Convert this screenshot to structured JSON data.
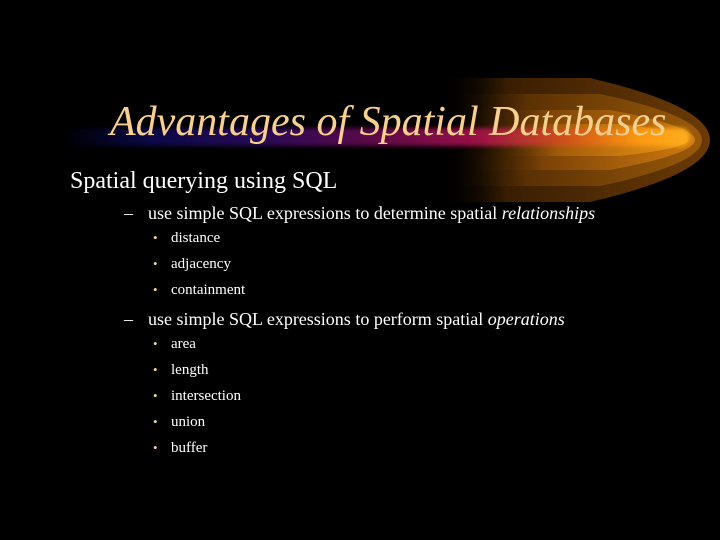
{
  "slide": {
    "title": "Advantages of Spatial Databases",
    "colors": {
      "background": "#000000",
      "title": "#f7cf8f",
      "text": "#ffffff",
      "bullet": "#f1cf95",
      "glow": "#ff9a10"
    },
    "level1": "Spatial querying using SQL",
    "sections": [
      {
        "dash": "–",
        "text": "use simple SQL expressions to determine spatial ",
        "emphasis": "relationships",
        "items": [
          "distance",
          "adjacency",
          "containment"
        ]
      },
      {
        "dash": "–",
        "text": "use simple SQL expressions to perform spatial ",
        "emphasis": "operations",
        "items": [
          "area",
          "length",
          "intersection",
          "union",
          "buffer"
        ]
      }
    ],
    "bullet_glyph": "•"
  }
}
